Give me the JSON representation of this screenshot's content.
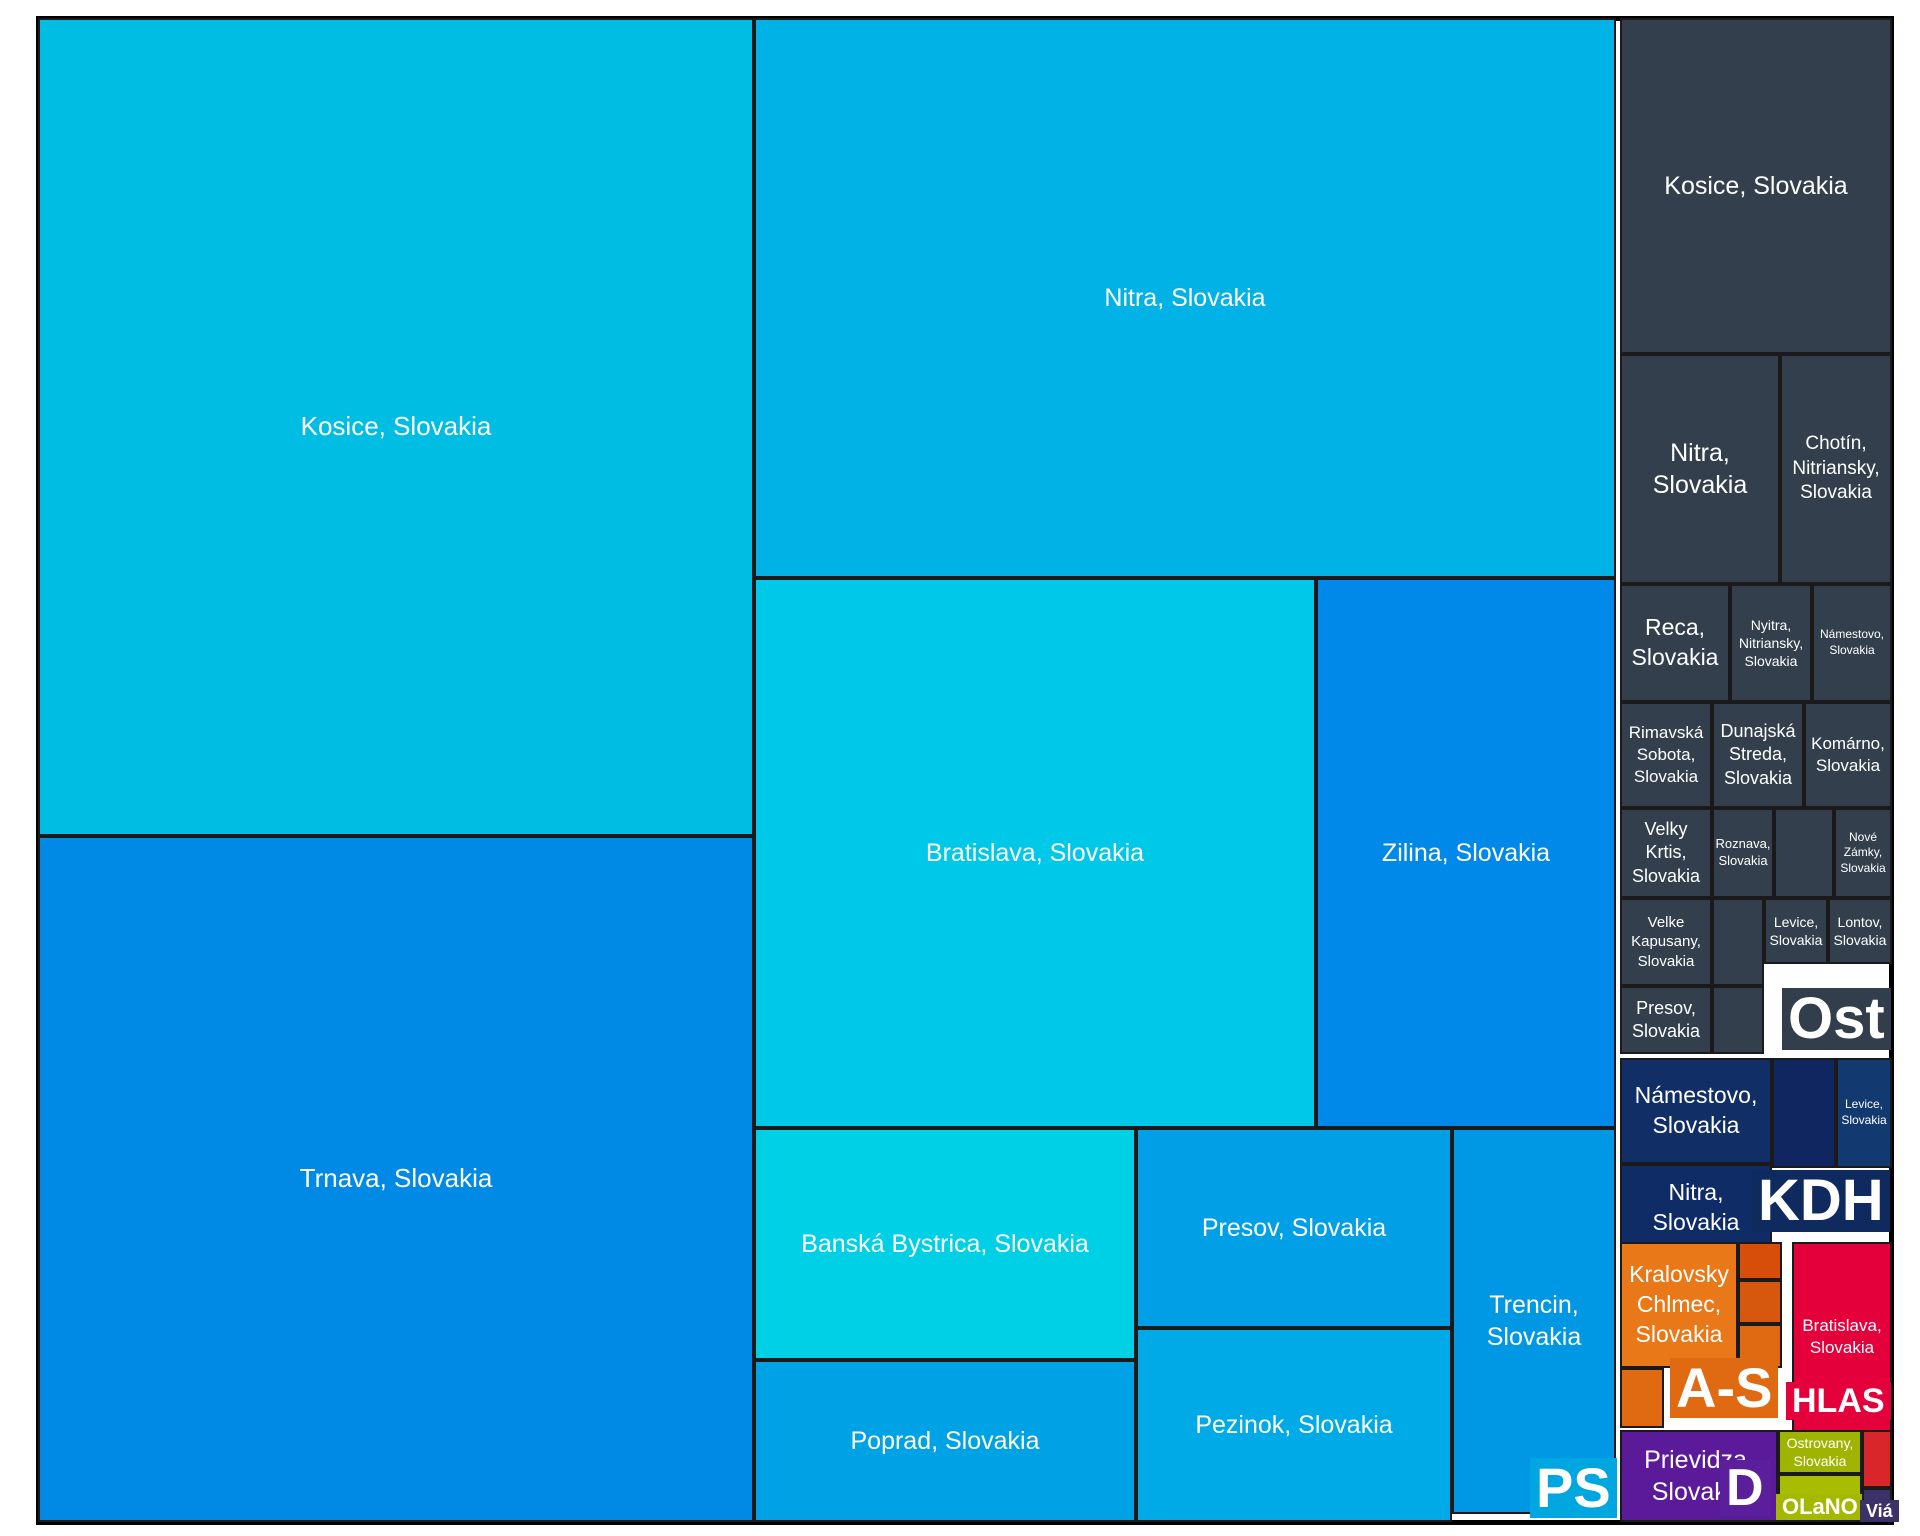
{
  "chart_data": {
    "type": "treemap",
    "groups": [
      {
        "name": "PS",
        "color": "#00a6e0",
        "items": [
          {
            "label": "Kosice, Slovakia",
            "color": "#00bde4"
          },
          {
            "label": "Trnava, Slovakia",
            "color": "#008ae6"
          },
          {
            "label": "Nitra, Slovakia",
            "color": "#00b2e5"
          },
          {
            "label": "Bratislava, Slovakia",
            "color": "#00c8e8"
          },
          {
            "label": "Zilina, Slovakia",
            "color": "#0089e8"
          },
          {
            "label": "Banská Bystrica, Slovakia",
            "color": "#00d0e6"
          },
          {
            "label": "Presov, Slovakia",
            "color": "#009fe6"
          },
          {
            "label": "Trencin, Slovakia",
            "color": "#0098e4"
          },
          {
            "label": "Poprad, Slovakia",
            "color": "#00a2e6"
          },
          {
            "label": "Pezinok, Slovakia",
            "color": "#00aae6"
          }
        ]
      },
      {
        "name": "Ost",
        "color": "#323e4c",
        "items": [
          {
            "label": "Kosice, Slovakia",
            "color": "#333f4d"
          },
          {
            "label": "Nitra, Slovakia",
            "color": "#333f4d"
          },
          {
            "label": "Chotín, Nitriansky, Slovakia",
            "color": "#333f4d"
          },
          {
            "label": "Reca, Slovakia",
            "color": "#333f4d"
          },
          {
            "label": "Nyitra, Nitriansky, Slovakia",
            "color": "#333f4d"
          },
          {
            "label": "Námestovo, Slovakia",
            "color": "#333f4d"
          },
          {
            "label": "Rimavská Sobota, Slovakia",
            "color": "#333f4d"
          },
          {
            "label": "Dunajská Streda, Slovakia",
            "color": "#333f4d"
          },
          {
            "label": "Komárno, Slovakia",
            "color": "#333f4d"
          },
          {
            "label": "Velky Krtis, Slovakia",
            "color": "#333f4d"
          },
          {
            "label": "Roznava, Slovakia",
            "color": "#333f4d"
          },
          {
            "label": "",
            "color": "#333f4d"
          },
          {
            "label": "Nové Zámky, Slovakia",
            "color": "#333f4d"
          },
          {
            "label": "Velke Kapusany, Slovakia",
            "color": "#333f4d"
          },
          {
            "label": "",
            "color": "#333f4d"
          },
          {
            "label": "Levice, Slovakia",
            "color": "#333f4d"
          },
          {
            "label": "Lontov, Slovakia",
            "color": "#333f4d"
          },
          {
            "label": "Presov, Slovakia",
            "color": "#333f4d"
          },
          {
            "label": "",
            "color": "#333f4d"
          }
        ]
      },
      {
        "name": "KDH",
        "color": "#0f2a5e",
        "items": [
          {
            "label": "Námestovo, Slovakia",
            "color": "#112f66"
          },
          {
            "label": "",
            "color": "#0f2660"
          },
          {
            "label": "Levice, Slovakia",
            "color": "#123a70"
          },
          {
            "label": "Nitra, Slovakia",
            "color": "#0f2c66"
          }
        ]
      },
      {
        "name": "A-S",
        "color": "#e06a12",
        "items": [
          {
            "label": "Kralovsky Chlmec, Slovakia",
            "color": "#e87818"
          },
          {
            "label": "",
            "color": "#d64e0a"
          },
          {
            "label": "",
            "color": "#d6580e"
          },
          {
            "label": "",
            "color": "#e06a12"
          },
          {
            "label": "",
            "color": "#e06a12"
          }
        ]
      },
      {
        "name": "HLAS",
        "color": "#e4003a",
        "items": [
          {
            "label": "Bratislava, Slovakia",
            "color": "#e4003a"
          }
        ]
      },
      {
        "name": "D",
        "color": "#5c1f9c",
        "items": [
          {
            "label": "Prievidza, Slovakia",
            "color": "#5a1a9a"
          }
        ]
      },
      {
        "name": "OLaNO",
        "color": "#a4b800",
        "items": [
          {
            "label": "Ostrovany, Slovakia",
            "color": "#9fb400"
          },
          {
            "label": "",
            "color": "#a8bc00"
          }
        ]
      },
      {
        "name": "",
        "color": "#d8262a",
        "items": [
          {
            "label": "",
            "color": "#d8262a"
          }
        ]
      },
      {
        "name": "Viá",
        "color": "#3c3268",
        "items": [
          {
            "label": "",
            "color": "#3c3268"
          }
        ]
      }
    ]
  }
}
